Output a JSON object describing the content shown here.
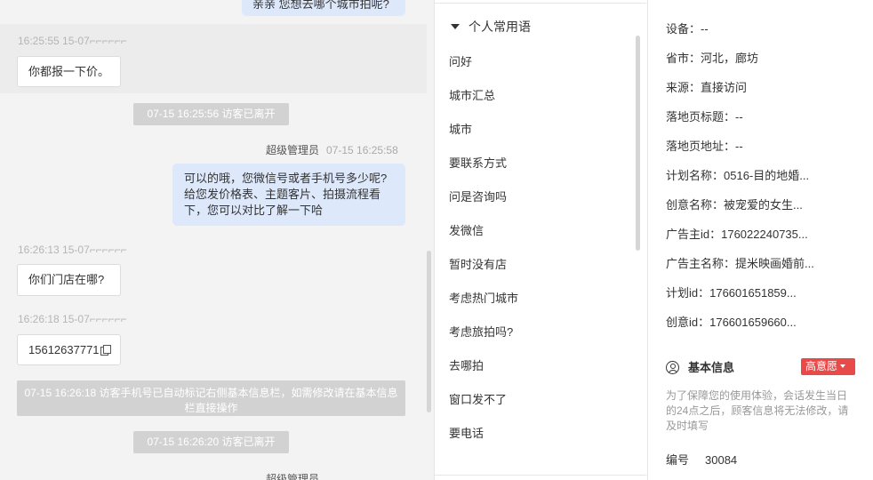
{
  "chat": {
    "top_bubble": "亲亲 您想去哪个城市拍呢?",
    "msg1": {
      "meta": "16:25:55 15-07⌐⌐⌐⌐⌐⌐",
      "text": "你都报一下价。"
    },
    "sys1": "07-15 16:25:56 访客已离开",
    "agent1": {
      "name": "超级管理员",
      "time": "07-15 16:25:58",
      "text": "可以的哦，您微信号或者手机号多少呢?给您发价格表、主题客片、拍摄流程看下，您可以对比了解一下哈"
    },
    "msg2": {
      "meta": "16:26:13 15-07⌐⌐⌐⌐⌐⌐",
      "text": "你们门店在哪?"
    },
    "msg3": {
      "meta": "16:26:18 15-07⌐⌐⌐⌐⌐⌐",
      "text": "15612637771"
    },
    "sys2": "07-15 16:26:18 访客手机号已自动标记右侧基本信息栏，如需修改请在基本信息栏直接操作",
    "sys3": "07-15 16:26:20 访客已离开",
    "agent_bottom_name": "超级管理员"
  },
  "phrases": {
    "header": "个人常用语",
    "items": [
      "问好",
      "城市汇总",
      "城市",
      "要联系方式",
      "问是咨询吗",
      "发微信",
      "暂时没有店",
      "考虑热门城市",
      "考虑旅拍吗?",
      "去哪拍",
      "窗口发不了",
      "要电话"
    ]
  },
  "info": {
    "rows": [
      "设备：--",
      "省市：河北，廊坊",
      "来源：直接访问",
      "落地页标题：--",
      "落地页地址：--",
      "计划名称：0516-目的地婚...",
      "创意名称：被宠爱的女生...",
      "广告主id：176022240735...",
      "广告主名称：提米映画婚前...",
      "计划id：176601651859...",
      "创意id：176601659660..."
    ],
    "basic_title": "基本信息",
    "intent": "高意愿",
    "intent_color": "#e84a4a",
    "note": "为了保障您的使用体验，会话发生当日的24点之后，顾客信息将无法修改，请及时填写",
    "serial_label": "编号",
    "serial_value": "30084"
  }
}
